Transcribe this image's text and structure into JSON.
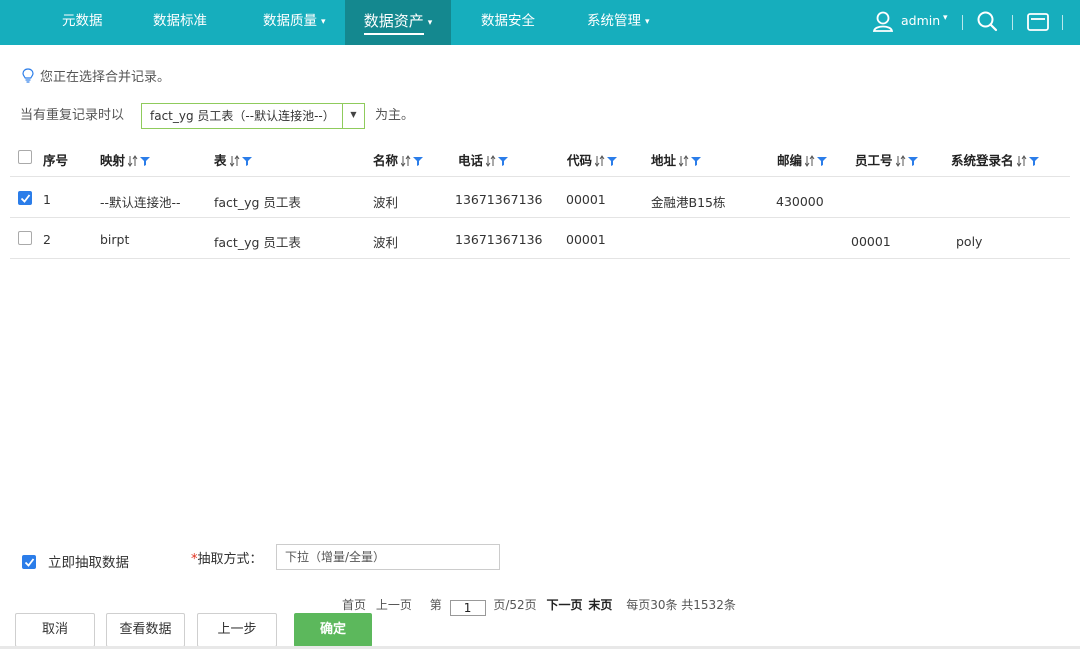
{
  "nav": {
    "items": [
      {
        "label": "元数据",
        "caret": false
      },
      {
        "label": "数据标准",
        "caret": false
      },
      {
        "label": "数据质量",
        "caret": true
      },
      {
        "label": "数据资产",
        "caret": true,
        "active": true
      },
      {
        "label": "数据安全",
        "caret": false
      },
      {
        "label": "系统管理",
        "caret": true
      }
    ],
    "user": "admin",
    "caret": "▾",
    "icons": [
      "user-icon",
      "search-icon",
      "mail-icon"
    ]
  },
  "hint": "您正在选择合并记录。",
  "primary": {
    "prefix": "当有重复记录时以",
    "selected": "fact_yg 员工表（--默认连接池--）",
    "suffix": "为主。"
  },
  "table": {
    "columns": [
      "序号",
      "映射",
      "表",
      "名称",
      "电话",
      "代码",
      "地址",
      "邮编",
      "员工号",
      "系统登录名"
    ],
    "rows": [
      {
        "checked": true,
        "cells": [
          "1",
          "--默认连接池--",
          "fact_yg 员工表",
          "波利",
          "13671367136",
          "00001",
          "金融港B15栋",
          "430000",
          "",
          ""
        ]
      },
      {
        "checked": false,
        "cells": [
          "2",
          "birpt",
          "fact_yg 员工表",
          "波利",
          "13671367136",
          "00001",
          "",
          "",
          "00001",
          "poly"
        ]
      }
    ]
  },
  "extract": {
    "checkbox_label": "立即抽取数据",
    "checked": true,
    "required_mark": "*",
    "mode_label": "抽取方式：",
    "mode_value": "下拉（增量/全量）"
  },
  "pager": {
    "first": "首页",
    "prev": "上一页",
    "page_prefix": "第",
    "current": "1",
    "page_suffix": "页/52页",
    "next": "下一页",
    "last": "末页",
    "summary": "每页30条 共1532条"
  },
  "buttons": {
    "cancel": "取消",
    "view": "查看数据",
    "back": "上一步",
    "confirm": "确定"
  },
  "colors": {
    "nav_bg": "#16aebd",
    "nav_active": "#14888f",
    "accent_blue": "#2b7de9",
    "confirm_green": "#5cb85c"
  }
}
